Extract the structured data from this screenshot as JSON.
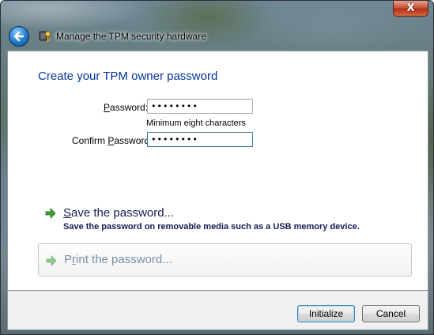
{
  "window": {
    "title": "Manage the TPM security hardware",
    "close_glyph": "X"
  },
  "heading": "Create your TPM owner password",
  "form": {
    "password_label": "Password:",
    "password_value": "••••••••",
    "hint": "Minimum eight characters",
    "confirm_label": "Confirm Password:",
    "confirm_value": "••••••••"
  },
  "options": [
    {
      "title": "Save the password...",
      "description": "Save the password on removable media such as a USB memory device.",
      "icon": "green-arrow-icon"
    },
    {
      "title": "Print the password...",
      "icon": "green-arrow-icon"
    }
  ],
  "footer": {
    "initialize_label": "Initialize",
    "cancel_label": "Cancel"
  },
  "colors": {
    "heading": "#003399",
    "link_text": "#151c55",
    "disabled_link_text": "#7a8fa6"
  }
}
